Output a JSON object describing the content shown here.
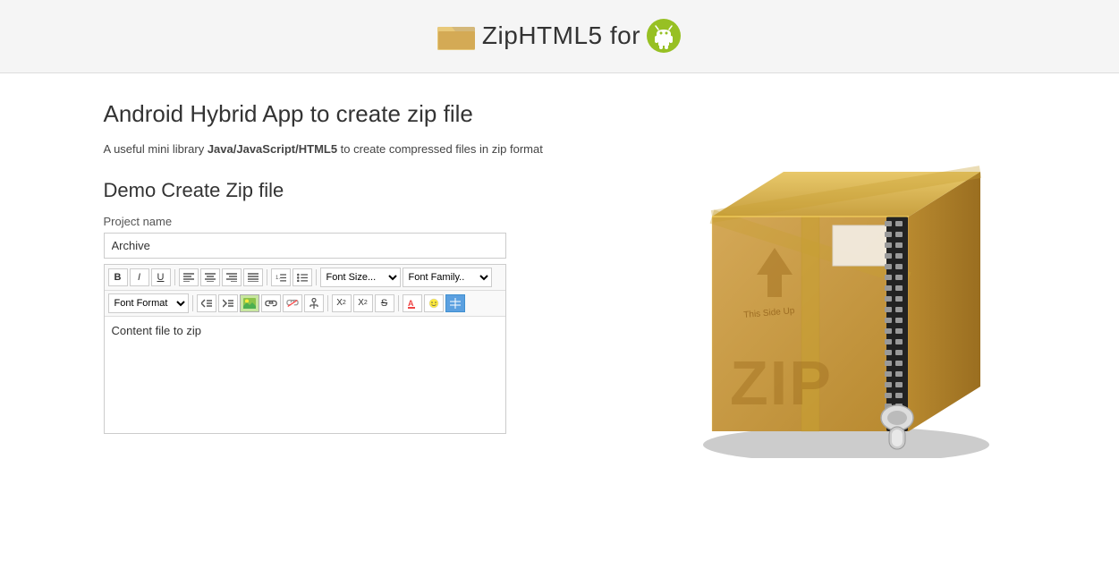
{
  "header": {
    "title": "ZipHTML5 for",
    "folder_icon_alt": "folder-icon",
    "android_icon_alt": "android-icon"
  },
  "main": {
    "page_title": "Android Hybrid App to create zip file",
    "description_normal": "A useful mini library ",
    "description_bold": "Java/JavaScript/HTML5",
    "description_end": " to create compressed files in zip format",
    "section_title": "Demo Create Zip file",
    "form": {
      "project_name_label": "Project name",
      "project_name_value": "Archive",
      "project_name_placeholder": "Archive"
    },
    "toolbar": {
      "bold_label": "B",
      "italic_label": "I",
      "underline_label": "U",
      "align_left": "≡",
      "align_center": "≡",
      "align_right": "≡",
      "align_justify": "≡",
      "list_ol": "≡",
      "list_ul": "≡",
      "font_size_label": "Font Size...",
      "font_family_label": "Font Family..",
      "font_format_label": "Font Format",
      "editor_content": "Content file to zip"
    }
  }
}
